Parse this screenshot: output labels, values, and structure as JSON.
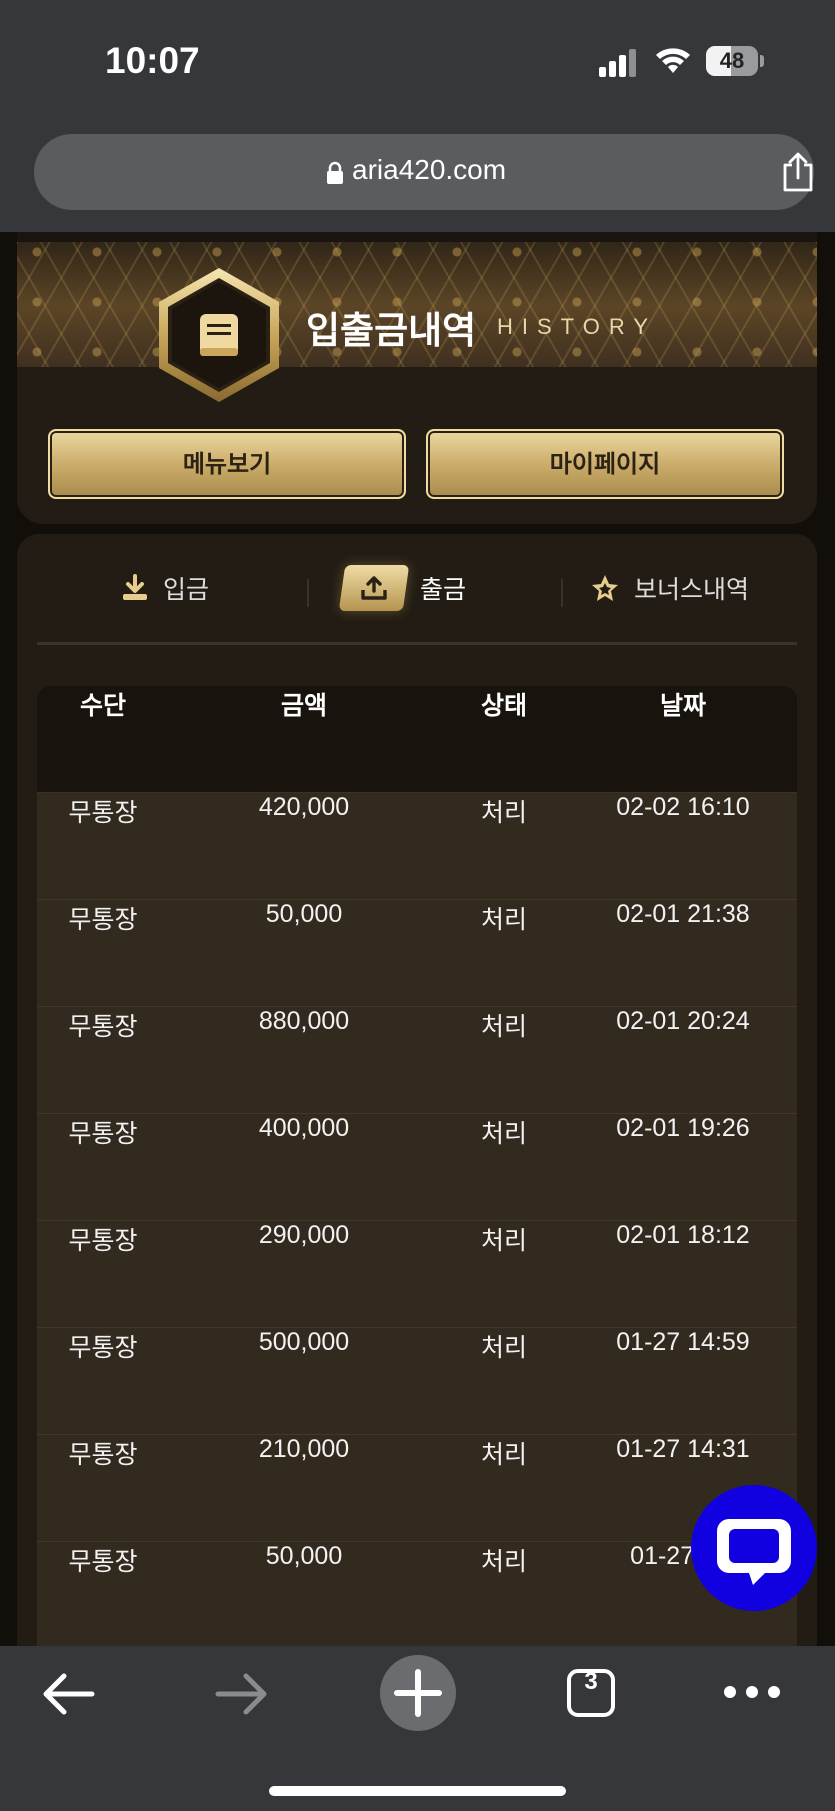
{
  "status_bar": {
    "time": "10:07",
    "battery_level": "48"
  },
  "browser": {
    "url": "aria420.com",
    "tab_count": "3"
  },
  "header": {
    "title_ko": "입출금내역",
    "title_en": "HISTORY",
    "menu_button": "메뉴보기",
    "mypage_button": "마이페이지"
  },
  "tabs": {
    "deposit": "입금",
    "withdraw": "출금",
    "bonus": "보너스내역",
    "active": "withdraw"
  },
  "table": {
    "headers": [
      "수단",
      "금액",
      "상태",
      "날짜"
    ],
    "rows": [
      [
        "무통장",
        "420,000",
        "처리",
        "02-02 16:10"
      ],
      [
        "무통장",
        "50,000",
        "처리",
        "02-01 21:38"
      ],
      [
        "무통장",
        "880,000",
        "처리",
        "02-01 20:24"
      ],
      [
        "무통장",
        "400,000",
        "처리",
        "02-01 19:26"
      ],
      [
        "무통장",
        "290,000",
        "처리",
        "02-01 18:12"
      ],
      [
        "무통장",
        "500,000",
        "처리",
        "01-27 14:59"
      ],
      [
        "무통장",
        "210,000",
        "처리",
        "01-27 14:31"
      ],
      [
        "무통장",
        "50,000",
        "처리",
        "01-27 13:"
      ]
    ]
  },
  "colors": {
    "gold": "#c8a967",
    "panel": "#221c14",
    "row": "#332a1f",
    "chat_button": "#1100e0"
  }
}
